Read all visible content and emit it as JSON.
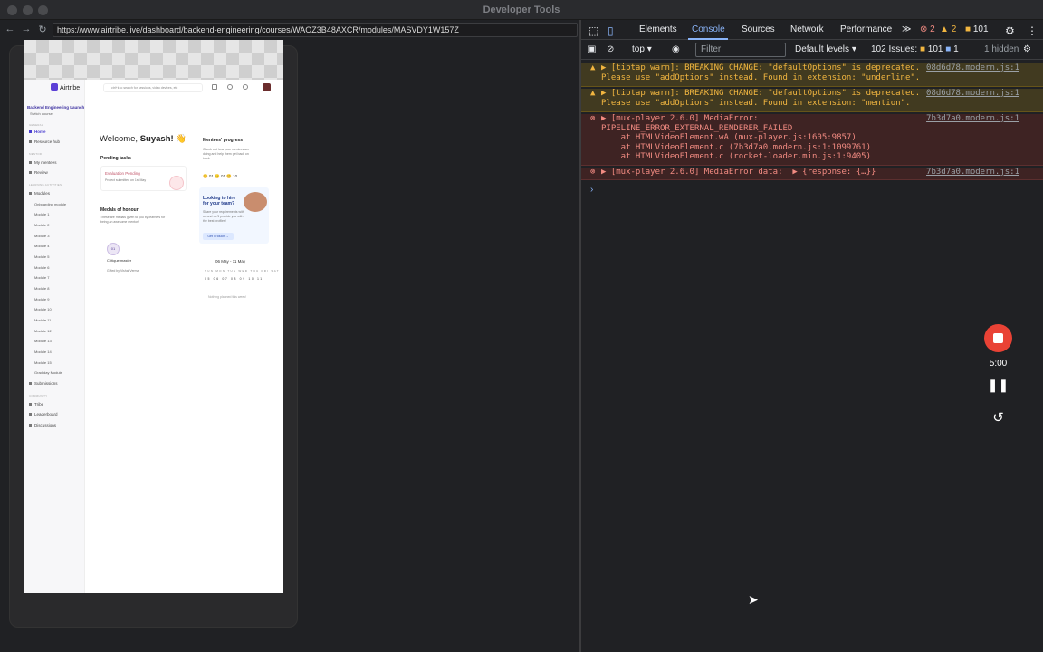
{
  "window": {
    "title": "Developer Tools"
  },
  "browser": {
    "url": "https://www.airtribe.live/dashboard/backend-engineering/courses/WAOZ3B48AXCR/modules/MASVDY1W157Z"
  },
  "page": {
    "logo_text": "Airtribe",
    "search_placeholder": "ctrl+k to search for sessions, video devices, etc",
    "course_name": "Backend Engineering Launch",
    "switch_course": "Switch course",
    "sidebar": {
      "general_heading": "GENERAL",
      "home": "Home",
      "resource_hub": "Resource hub",
      "mentor_heading": "MENTOR",
      "my_mentees": "My mentees",
      "review": "Review",
      "learning_heading": "LEARNING ACTIVITIES",
      "modules": "Modules",
      "module_items": [
        "Onboarding module",
        "Module 1",
        "Module 2",
        "Module 3",
        "Module 4",
        "Module 5",
        "Module 6",
        "Module 7",
        "Module 8",
        "Module 9",
        "Module 10",
        "Module 11",
        "Module 12",
        "Module 13",
        "Module 14",
        "Module 15",
        "Grad day Module"
      ],
      "submissions": "Submissions",
      "community_heading": "COMMUNITY",
      "tribe": "Tribe",
      "leaderboard": "Leaderboard",
      "discussions": "Discussions"
    },
    "welcome_prefix": "Welcome,",
    "welcome_name": "Suyash!",
    "welcome_emoji": "👋",
    "pending_title": "Pending tasks",
    "pending_task": "Evaluation Pending",
    "pending_sub": "Project submitted on 1st May",
    "medals_title": "Medals of honour",
    "medals_desc_1": "These are medals given to you by learners for",
    "medals_desc_2": "being an awesome mentor!",
    "medal_badge": "01",
    "medal_name": "Critique master",
    "medal_by": "Gifted by Vishal Verma",
    "progress_title": "Mentees' progress",
    "progress_desc_1": "Check out how your mentees are",
    "progress_desc_2": "doing and help them get back on",
    "progress_desc_3": "track",
    "progress_counts": "😊 01   😐 01   😀 10",
    "hire_title_1": "Looking to hire",
    "hire_title_2": "for your team?",
    "hire_desc_1": "Share your requirements with",
    "hire_desc_2": "us and we'll provide you with",
    "hire_desc_3": "the best profiles!",
    "hire_button": "Get in touch →",
    "calendar_range": "06 May - 11 May",
    "calendar_days": "SUN MON TUE WED THU FRI SAT",
    "calendar_dates": "05 06 07 08 09 10 11",
    "calendar_empty": "Nothing planned this week!"
  },
  "devtools": {
    "tabs": [
      "Elements",
      "Console",
      "Sources",
      "Network",
      "Performance"
    ],
    "active_tab": "Console",
    "more": "≫",
    "err_count": "2",
    "warn_count": "2",
    "issues_badge": "101",
    "context": "top",
    "filter_placeholder": "Filter",
    "levels": "Default levels",
    "issues_label": "102 Issues:",
    "issues_warn": "101",
    "issues_info": "1",
    "hidden": "1 hidden",
    "messages": [
      {
        "type": "warn",
        "lines": "▶ [tiptap warn]: BREAKING CHANGE: \"defaultOptions\" is deprecated.\nPlease use \"addOptions\" instead. Found in extension: \"underline\".",
        "source": "08d6d78.modern.js:1"
      },
      {
        "type": "warn",
        "lines": "▶ [tiptap warn]: BREAKING CHANGE: \"defaultOptions\" is deprecated.\nPlease use \"addOptions\" instead. Found in extension: \"mention\".",
        "source": "08d6d78.modern.js:1"
      },
      {
        "type": "err",
        "lines": "▶ [mux-player 2.6.0] MediaError:\nPIPELINE_ERROR_EXTERNAL_RENDERER_FAILED\n    at HTMLVideoElement.wA (mux-player.js:1605:9857)\n    at HTMLVideoElement.c (7b3d7a0.modern.js:1:1099761)\n    at HTMLVideoElement.c (rocket-loader.min.js:1:9405)",
        "source": "7b3d7a0.modern.js:1"
      },
      {
        "type": "err",
        "lines": "▶ [mux-player 2.6.0] MediaError data:  ▶ {response: {…}}",
        "source": "7b3d7a0.modern.js:1"
      }
    ],
    "prompt": "›"
  },
  "recorder": {
    "time": "5:00"
  }
}
